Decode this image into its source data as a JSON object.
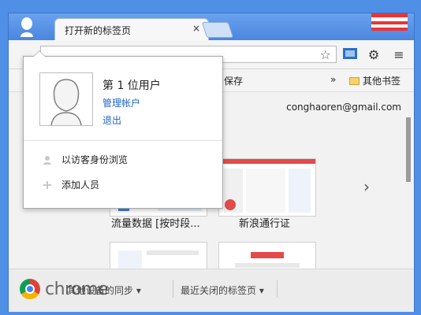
{
  "tab": {
    "title": "打开新的标签页",
    "close": "×"
  },
  "toolbar": {
    "star": "☆",
    "settings": "⚙",
    "menu": "≡"
  },
  "bookmarks": {
    "item1": "保存",
    "more": "»",
    "other": "其他书签"
  },
  "content": {
    "email": "conghaoren@gmail.com",
    "thumb1_label": "流量数据 [按时段...",
    "thumb2_label": "新浪通行证",
    "next_arrow": "›"
  },
  "bottom": {
    "brand": "chrome",
    "sync": "其他设备的同步 ▾",
    "recent": "最近关闭的标签页 ▾"
  },
  "popup": {
    "user_name": "第 1 位用户",
    "manage": "管理帐户",
    "logout": "退出",
    "guest": "以访客身份浏览",
    "add_person": "添加人员"
  },
  "icons": {
    "avatar": "person-silhouette-icon",
    "close": "close-icon",
    "star": "bookmark-star-icon",
    "cast": "cast-icon",
    "gear": "gear-icon",
    "menu": "hamburger-menu-icon",
    "folder": "folder-icon",
    "guest": "guest-icon",
    "add": "add-person-icon"
  }
}
